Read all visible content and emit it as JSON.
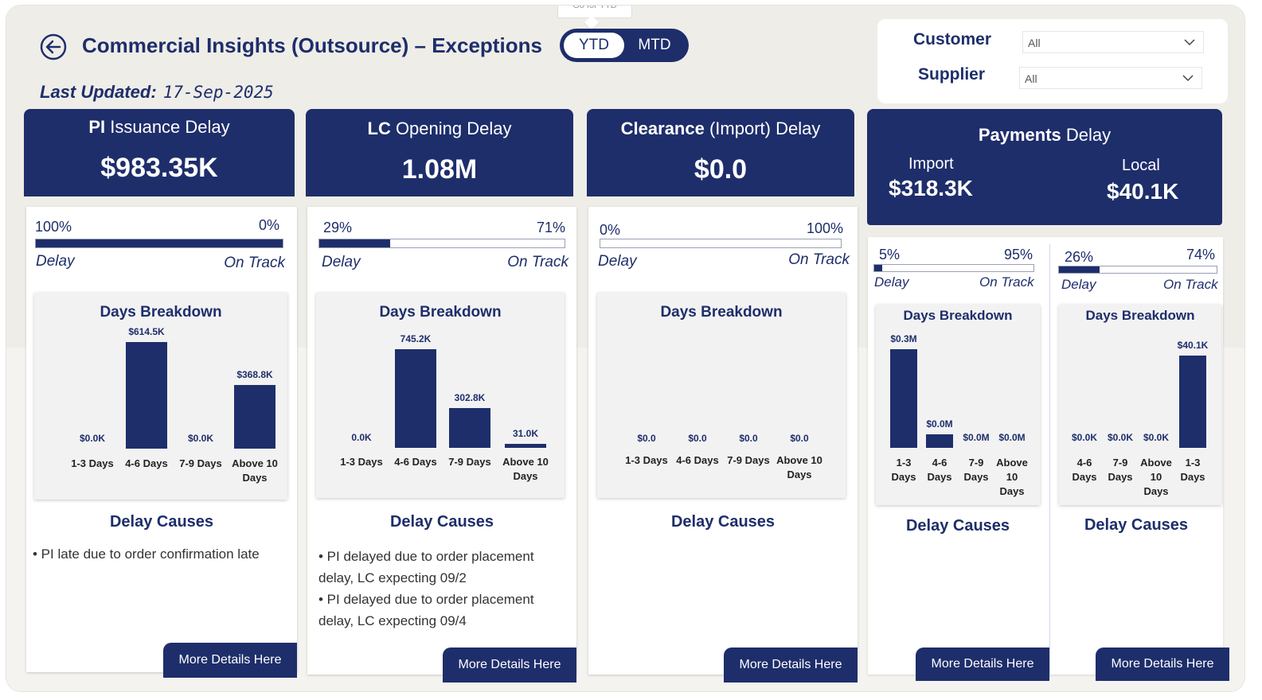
{
  "header": {
    "title": "Commercial Insights (Outsource) – Exceptions",
    "last_updated_label": "Last Updated:",
    "last_updated_value": "17-Sep-2025",
    "tooltip": "Go for YTD",
    "toggle": {
      "ytd": "YTD",
      "mtd": "MTD",
      "selected": "YTD"
    }
  },
  "filters": {
    "customer_label": "Customer",
    "customer_value": "All",
    "supplier_label": "Supplier",
    "supplier_value": "All"
  },
  "common": {
    "delay_label": "Delay",
    "on_track_label": "On Track",
    "days_breakdown": "Days Breakdown",
    "delay_causes": "Delay Causes",
    "more_details": "More Details Here"
  },
  "colors": {
    "navy": "#1e2e6b",
    "background": "#efede8"
  },
  "panels": [
    {
      "title_bold": "PI",
      "title_rest": " Issuance Delay",
      "value": "$983.35K",
      "delay_pct": "100%",
      "ontrack_pct": "0%",
      "delay_fraction": 1.0,
      "causes": [
        "• PI late due to order confirmation late"
      ]
    },
    {
      "title_bold": "LC",
      "title_rest": " Opening Delay",
      "value": "1.08M",
      "delay_pct": "29%",
      "ontrack_pct": "71%",
      "delay_fraction": 0.29,
      "causes": [
        "• PI delayed due to order placement delay, LC expecting 09/2",
        "• PI delayed due to order placement delay, LC expecting 09/4"
      ]
    },
    {
      "title_bold": "Clearance",
      "title_rest": " (Import) Delay",
      "value": "$0.0",
      "delay_pct": "0%",
      "ontrack_pct": "100%",
      "delay_fraction": 0.0,
      "causes": []
    },
    {
      "title_bold": "Payments",
      "title_rest": " Delay",
      "import_label": "Import",
      "import_value": "$318.3K",
      "local_label": "Local",
      "local_value": "$40.1K",
      "import": {
        "delay_pct": "5%",
        "ontrack_pct": "95%",
        "delay_fraction": 0.05
      },
      "local": {
        "delay_pct": "26%",
        "ontrack_pct": "74%",
        "delay_fraction": 0.26
      }
    }
  ],
  "chart_data": [
    {
      "type": "bar",
      "title": "Days Breakdown",
      "categories": [
        "1-3 Days",
        "4-6 Days",
        "7-9 Days",
        "Above 10 Days"
      ],
      "values": [
        0,
        614.5,
        0,
        368.8
      ],
      "labels": [
        "$0.0K",
        "$614.5K",
        "$0.0K",
        "$368.8K"
      ],
      "unit": "K"
    },
    {
      "type": "bar",
      "title": "Days Breakdown",
      "categories": [
        "1-3 Days",
        "4-6 Days",
        "7-9 Days",
        "Above 10 Days"
      ],
      "values": [
        0,
        745.2,
        302.8,
        31.0
      ],
      "labels": [
        "0.0K",
        "745.2K",
        "302.8K",
        "31.0K"
      ],
      "unit": "K"
    },
    {
      "type": "bar",
      "title": "Days Breakdown",
      "categories": [
        "1-3 Days",
        "4-6 Days",
        "7-9 Days",
        "Above 10 Days"
      ],
      "values": [
        0,
        0,
        0,
        0
      ],
      "labels": [
        "$0.0",
        "$0.0",
        "$0.0",
        "$0.0"
      ],
      "unit": ""
    },
    {
      "type": "bar",
      "title": "Days Breakdown",
      "categories": [
        "1-3 Days",
        "4-6 Days",
        "7-9 Days",
        "Above 10 Days"
      ],
      "values": [
        0.3,
        0.04,
        0,
        0
      ],
      "labels": [
        "$0.3M",
        "$0.0M",
        "$0.0M",
        "$0.0M"
      ],
      "unit": "M"
    },
    {
      "type": "bar",
      "title": "Days Breakdown",
      "categories": [
        "4-6 Days",
        "7-9 Days",
        "Above 10 Days",
        "1-3 Days"
      ],
      "values": [
        0,
        0,
        0,
        40.1
      ],
      "labels": [
        "$0.0K",
        "$0.0K",
        "$0.0K",
        "$40.1K"
      ],
      "unit": "K"
    }
  ]
}
